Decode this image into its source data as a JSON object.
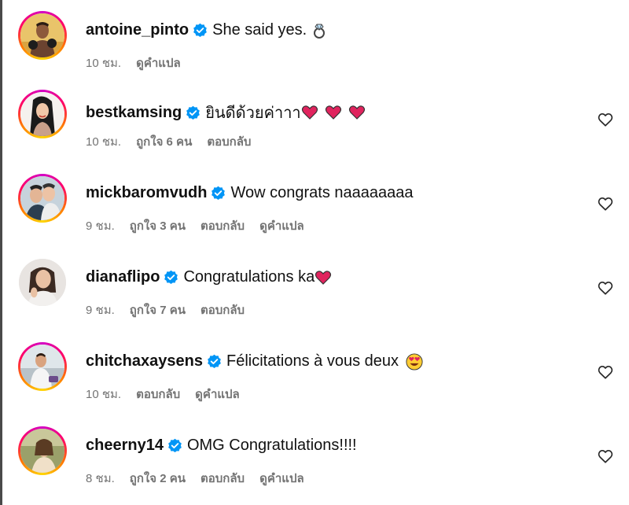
{
  "comments": [
    {
      "username": "antoine_pinto",
      "text": "She said yes.",
      "emoji": "ring-emoji",
      "time": "10 ชม.",
      "likes": "",
      "reply": "",
      "translate": "ดูคำแปล",
      "show_like_button": false,
      "story_ring": true
    },
    {
      "username": "bestkamsing",
      "text": "ยินดีด้วยค่าาา",
      "emoji": "heart-emoji-x3",
      "time": "10 ชม.",
      "likes": "ถูกใจ 6 คน",
      "reply": "ตอบกลับ",
      "translate": "",
      "show_like_button": true,
      "story_ring": true
    },
    {
      "username": "mickbaromvudh",
      "text": "Wow congrats naaaaaaaa",
      "emoji": "",
      "time": "9 ชม.",
      "likes": "ถูกใจ 3 คน",
      "reply": "ตอบกลับ",
      "translate": "ดูคำแปล",
      "show_like_button": true,
      "story_ring": true
    },
    {
      "username": "dianaflipo",
      "text": "Congratulations ka",
      "emoji": "heart-emoji",
      "time": "9 ชม.",
      "likes": "ถูกใจ 7 คน",
      "reply": "ตอบกลับ",
      "translate": "",
      "show_like_button": true,
      "story_ring": false
    },
    {
      "username": "chitchaxaysens",
      "text": "Félicitations à vous deux",
      "emoji": "heart-eyes-emoji",
      "time": "10 ชม.",
      "likes": "",
      "reply": "ตอบกลับ",
      "translate": "ดูคำแปล",
      "show_like_button": true,
      "story_ring": true
    },
    {
      "username": "cheerny14",
      "text": "OMG Congratulations!!!!",
      "emoji": "",
      "time": "8 ชม.",
      "likes": "ถูกใจ 2 คน",
      "reply": "ตอบกลับ",
      "translate": "ดูคำแปล",
      "show_like_button": true,
      "story_ring": true
    }
  ],
  "colors": {
    "verified": "#0095f6",
    "text": "#111111",
    "meta": "#737373",
    "heart": "#e0245e"
  },
  "icons": {
    "verified": "verified-badge-icon",
    "like": "heart-outline-icon"
  }
}
